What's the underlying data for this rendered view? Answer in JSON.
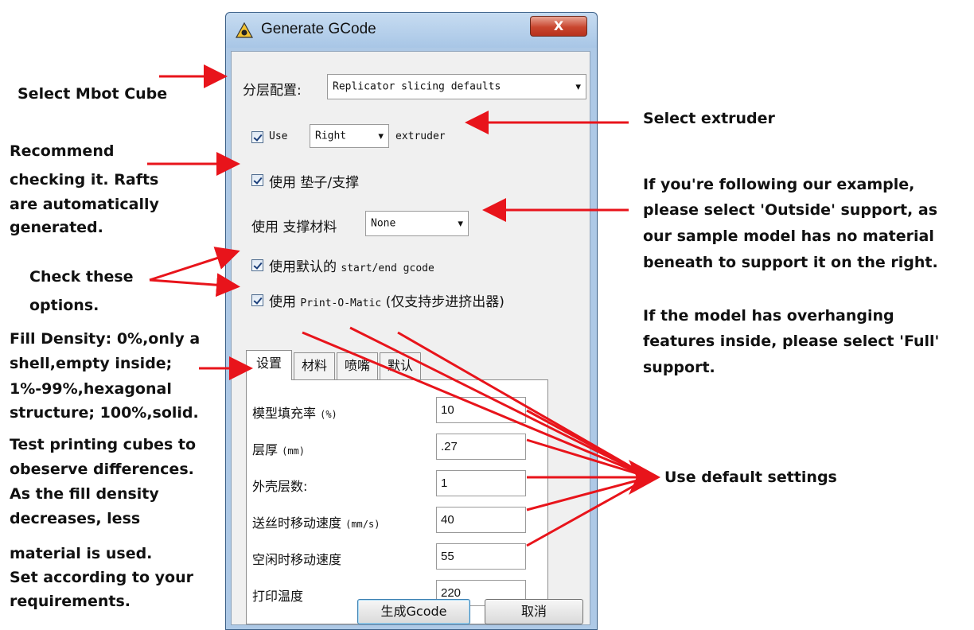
{
  "annotations": {
    "select_profile": "Select Mbot Cube",
    "select_extruder": "Select extruder",
    "recommend_1": "Recommend",
    "recommend_2": "checking it.  Rafts",
    "recommend_3": "are automatically",
    "recommend_4": "generated.",
    "support_1": "If you're following our example,",
    "support_2": "please select 'Outside' support, as",
    "support_3": "our sample model has no material",
    "support_4": "beneath to support it on the right.",
    "overhang_1": "If the model has overhanging",
    "overhang_2": "features inside, please select 'Full'",
    "overhang_3": "support.",
    "check_1": "Check these",
    "check_2": "options.",
    "fill_1": "Fill Density: 0%,only a",
    "fill_2": "shell,empty inside;",
    "fill_3": "1%-99%,hexagonal",
    "fill_4": "structure; 100%,solid.",
    "fill_5": "Test printing cubes to",
    "fill_6": "obeserve differences.",
    "fill_7": "As the fill density",
    "fill_8": "decreases, less",
    "fill_9": "material is used.",
    "fill_10": "Set according to your",
    "fill_11": "requirements.",
    "defaults": "Use default settings"
  },
  "dialog": {
    "title": "Generate GCode",
    "close_label": "X",
    "profile_label": "分层配置:",
    "profile_value": "Replicator slicing defaults",
    "use_label": "Use",
    "extruder_value": "Right",
    "extruder_suffix": "extruder",
    "raft_label": "使用  垫子/支撑",
    "support_label": "使用 支撑材料",
    "support_value": "None",
    "default_gcode_prefix": "使用默认的",
    "default_gcode_suffix": "start/end gcode",
    "printomatic_prefix": "使用",
    "printomatic_mid": "Print-O-Matic",
    "printomatic_suffix": "(仅支持步进挤出器)",
    "tabs": [
      "设置",
      "材料",
      "喷嘴",
      "默认"
    ],
    "rows": [
      {
        "label": "模型填充率",
        "unit": "(%)",
        "value": "10"
      },
      {
        "label": "层厚",
        "unit": "(mm)",
        "value": ".27"
      },
      {
        "label": "外壳层数:",
        "unit": "",
        "value": "1"
      },
      {
        "label": "送丝时移动速度",
        "unit": "(mm/s)",
        "value": "40"
      },
      {
        "label": "空闲时移动速度",
        "unit": "",
        "value": "55"
      },
      {
        "label": "打印温度",
        "unit": "",
        "value": "220"
      }
    ],
    "generate_button": "生成Gcode",
    "cancel_button": "取消"
  },
  "colors": {
    "arrow": "#e8141b",
    "title_bg": "#aec9e6"
  }
}
